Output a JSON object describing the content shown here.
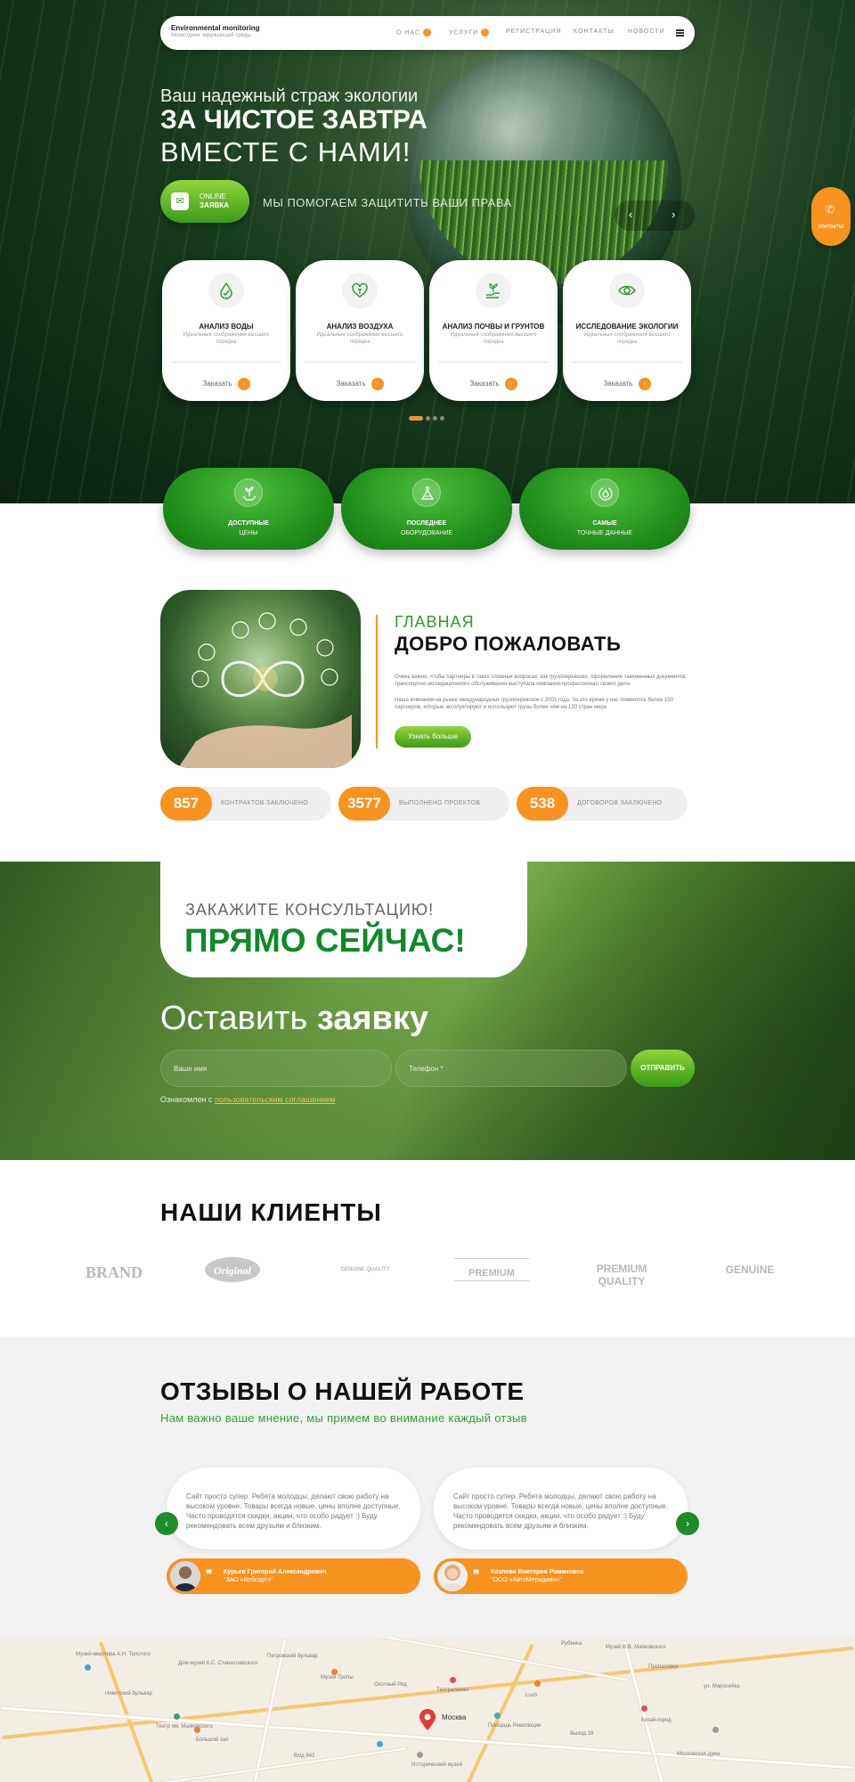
{
  "nav": {
    "brand": "Environmental monitoring",
    "tagline": "Мониторинг окружающей среды",
    "items": [
      "О НАС",
      "УСЛУГИ",
      "РЕГИСТРАЦИЯ",
      "КОНТАКТЫ",
      "НОВОСТИ"
    ]
  },
  "hero": {
    "subtitle": "Ваш надежный страж экологии",
    "title": "ЗА ЧИСТОЕ ЗАВТРА",
    "title2": "ВМЕСТЕ С НАМИ!",
    "online_line1": "ONLINE",
    "online_line2": "ЗАЯВКА",
    "help": "МЫ ПОМОГАЕМ ЗАЩИТИТЬ ВАШИ ПРАВА",
    "prev": "‹",
    "next": "›"
  },
  "contacts_button": "КОНТАКТЫ",
  "services": [
    {
      "title": "АНАЛИЗ ВОДЫ",
      "desc": "Идеальные соображения высшего порядка",
      "order": "Заказать",
      "icon": "water-drop-icon"
    },
    {
      "title": "АНАЛИЗ ВОЗДУХА",
      "desc": "Идеальные соображения высшего порядка",
      "order": "Заказать",
      "icon": "heart-leaf-icon"
    },
    {
      "title": "АНАЛИЗ ПОЧВЫ И ГРУНТОВ",
      "desc": "Идеальные соображения высшего порядка",
      "order": "Заказать",
      "icon": "hand-plant-icon"
    },
    {
      "title": "ИССЛЕДОВАНИЕ ЭКОЛОГИИ",
      "desc": "Идеальные соображения высшего порядка",
      "order": "Заказать",
      "icon": "eye-leaf-icon"
    }
  ],
  "features": [
    {
      "title": "ДОСТУПНЫЕ",
      "sub": "ЦЕНЫ",
      "icon": "hands-plant-icon"
    },
    {
      "title": "ПОСЛЕДНЕЕ",
      "sub": "ОБОРУДОВАНИЕ",
      "icon": "flask-icon"
    },
    {
      "title": "САМЫЕ",
      "sub": "ТОЧНЫЕ ДАННЫЕ",
      "icon": "drop-cycle-icon"
    }
  ],
  "welcome": {
    "kicker": "ГЛАВНАЯ",
    "title": "ДОБРО ПОЖАЛОВАТЬ",
    "p1": "Очень важно, чтобы партнеры в таких сложных вопросах, как грузоперевозки, оформление таможенных документов, транспортно-экспедиционного обслуживания выступала компания-профессионал своего дела",
    "p2": "Наша компания на рынке международных грузоперевозок с 2001 года. За это время у нас появилось более 150 партнеров, которые эксплуатируют и используют грузы более чем на 130 стран мира",
    "button": "Узнать больше"
  },
  "stats": [
    {
      "value": "857",
      "label": "КОНТРАКТОВ ЗАКЛЮЧЕНО"
    },
    {
      "value": "3577",
      "label": "ВЫПОЛНЕНО ПРОЕКТОВ"
    },
    {
      "value": "538",
      "label": "ДОГОВОРОВ ЗАКЛЮЧЕНО"
    }
  ],
  "consult": {
    "kicker": "ЗАКАЖИТЕ КОНСУЛЬТАЦИЮ!",
    "title": "ПРЯМО СЕЙЧАС!",
    "form_title_a": "Оставить",
    "form_title_b": "заявку",
    "name_placeholder": "Ваше имя",
    "phone_placeholder": "Телефон *",
    "submit": "ОТПРАВИТЬ",
    "agree_text": "Ознакомлен с",
    "agree_link": "пользовательским соглашением"
  },
  "clients": {
    "title": "НАШИ КЛИЕНТЫ",
    "logos": [
      "BRAND",
      "Original",
      "GENUINE QUALITY",
      "PREMIUM",
      "PREMIUM QUALITY",
      "GENUINE"
    ]
  },
  "reviews": {
    "title": "ОТЗЫВЫ О НАШЕЙ РАБОТЕ",
    "subtitle": "Нам важно ваше мнение, мы примем во внимание каждый отзыв",
    "items": [
      {
        "text": "Сайт просто супер. Ребята молодцы, делают свою работу на высоком уровне. Товары всегда новые, цены вполне доступные. Часто проводятся скидки, акции, что особо радует :) Буду рекомендовать всем друзьям и близким.",
        "name": "Курьев Григорий Александрович",
        "company": "\"ЗАО «Вебсорт»\""
      },
      {
        "text": "Сайт просто супер. Ребята молодцы, делают свою работу на высоком уровне. Товары всегда новые, цены вполне доступные. Часто проводятся скидки, акции, что особо радует :) Буду рекомендовать всем друзьям и близким.",
        "name": "Козлова Виктория Романовна",
        "company": "\"ООО «АвтоМеридиан»\""
      }
    ],
    "prev": "‹",
    "next": "›",
    "quote": "❞"
  },
  "map": {
    "city": "Москва",
    "labels": [
      "Музей-квартира А.Н. Толстого",
      "Дом-музей К.С. Станиславского",
      "Театр им. Маяковского",
      "Большой зал",
      "Охотный Ряд",
      "Театральная",
      "Площадь Революции",
      "Китай-город",
      "ул. Маросейка",
      "Рубинка",
      "Музей В.В. Маяковского",
      "Пропасовка",
      "Исторический музей",
      "Музей Тропы",
      "Петровский бульвар",
      "Lush",
      "Никитский бульвар",
      "Московская дума",
      "Выход 18",
      "Вхід 842"
    ]
  },
  "colors": {
    "accent_orange": "#f7931e",
    "brand_green": "#1f8c2a",
    "light_green": "#8fd43b"
  }
}
